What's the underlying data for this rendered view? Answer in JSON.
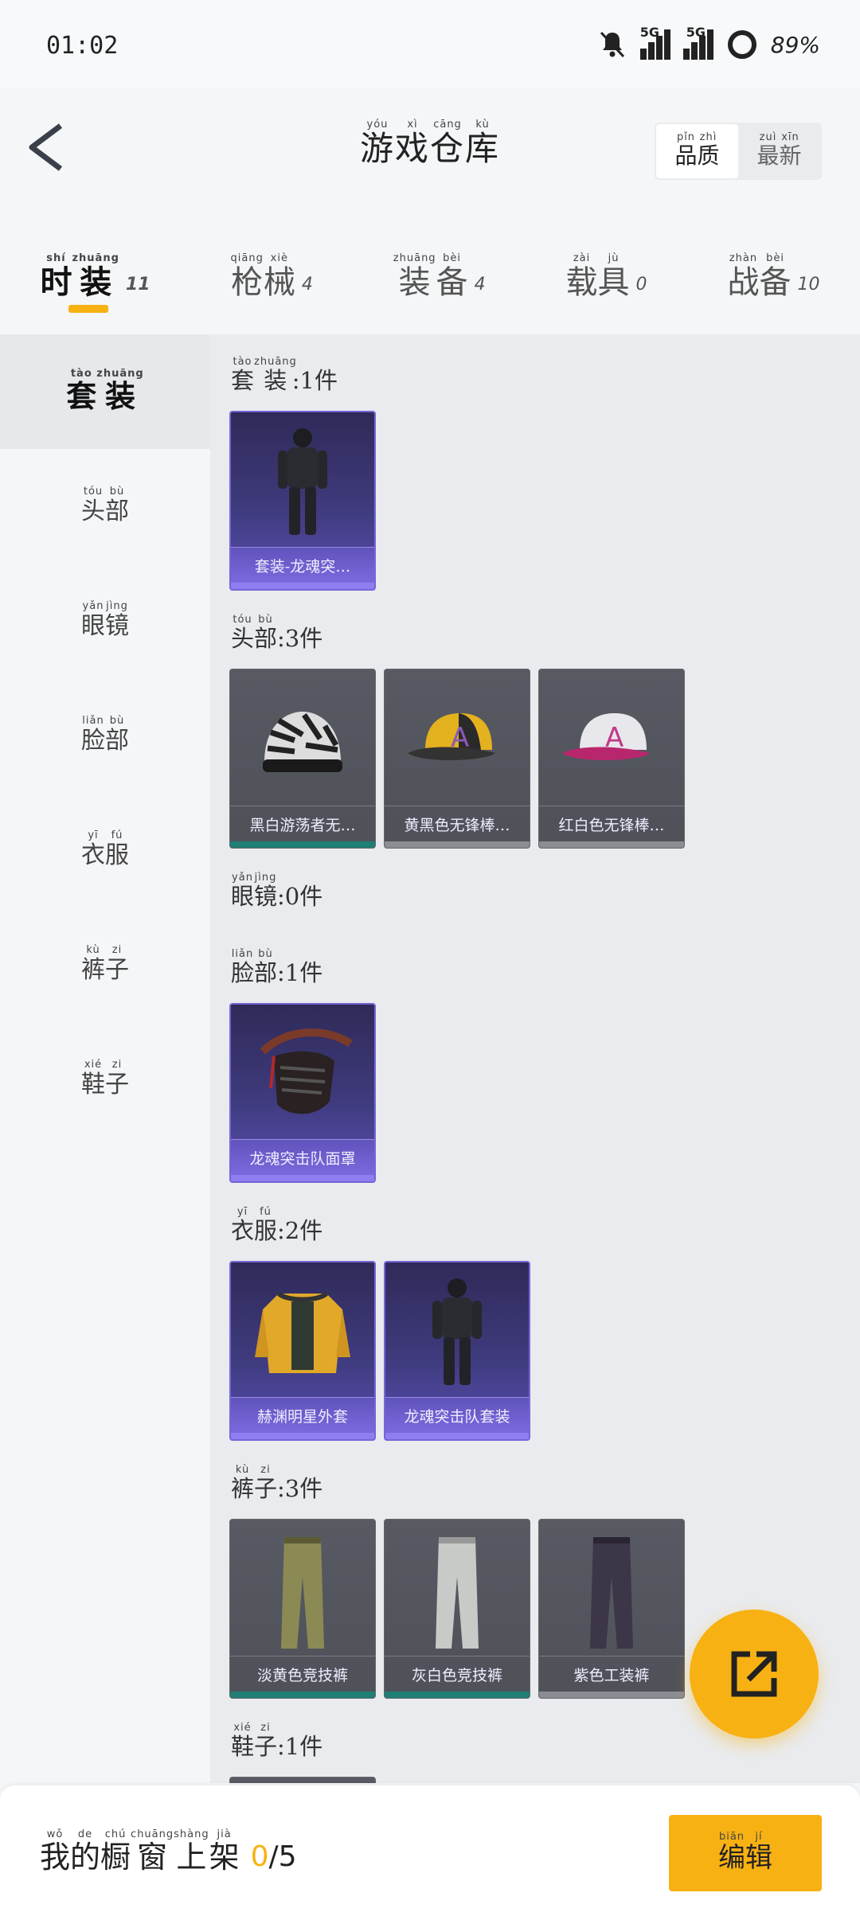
{
  "status_bar": {
    "time": "01:02",
    "signal_1": "5G",
    "signal_2": "5G",
    "battery": "89%"
  },
  "header": {
    "title": "游戏仓库",
    "title_pinyin": [
      "yóu",
      "xì",
      "cāng",
      "kù"
    ],
    "sort_options": [
      {
        "label": "品质",
        "pinyin": [
          "pǐn",
          "zhì"
        ],
        "active": true
      },
      {
        "label": "最新",
        "pinyin": [
          "zuì",
          "xīn"
        ],
        "active": false
      }
    ]
  },
  "tabs": [
    {
      "label": "时装",
      "pinyin": [
        "shí",
        "zhuāng"
      ],
      "count": "11",
      "active": true
    },
    {
      "label": "枪械",
      "pinyin": [
        "qiāng",
        "xiè"
      ],
      "count": "4",
      "active": false
    },
    {
      "label": "装备",
      "pinyin": [
        "zhuāng",
        "bèi"
      ],
      "count": "4",
      "active": false
    },
    {
      "label": "载具",
      "pinyin": [
        "zài",
        "jù"
      ],
      "count": "0",
      "active": false
    },
    {
      "label": "战备",
      "pinyin": [
        "zhàn",
        "bèi"
      ],
      "count": "10",
      "active": false
    }
  ],
  "sidebar": {
    "items": [
      {
        "label": "套装",
        "pinyin": [
          "tào",
          "zhuāng"
        ],
        "active": true
      },
      {
        "label": "头部",
        "pinyin": [
          "tóu",
          "bù"
        ],
        "active": false
      },
      {
        "label": "眼镜",
        "pinyin": [
          "yǎn",
          "jìng"
        ],
        "active": false
      },
      {
        "label": "脸部",
        "pinyin": [
          "liǎn",
          "bù"
        ],
        "active": false
      },
      {
        "label": "衣服",
        "pinyin": [
          "yī",
          "fú"
        ],
        "active": false
      },
      {
        "label": "裤子",
        "pinyin": [
          "kù",
          "zi"
        ],
        "active": false
      },
      {
        "label": "鞋子",
        "pinyin": [
          "xié",
          "zi"
        ],
        "active": false
      }
    ]
  },
  "sections": [
    {
      "label": "套装",
      "pinyin": [
        "tào",
        "zhuāng"
      ],
      "count": "1件",
      "items": [
        {
          "name": "套装-龙魂突…",
          "style": "purple",
          "icon": "armored-suit-icon"
        }
      ]
    },
    {
      "label": "头部",
      "pinyin": [
        "tóu",
        "bù"
      ],
      "count": "3件",
      "items": [
        {
          "name": "黑白游荡者无…",
          "style": "gray",
          "foot": "teal",
          "icon": "zebra-beanie-icon"
        },
        {
          "name": "黄黑色无锋棒…",
          "style": "gray",
          "foot": "gray",
          "icon": "yellow-cap-icon"
        },
        {
          "name": "红白色无锋棒…",
          "style": "gray",
          "foot": "gray",
          "icon": "pink-cap-icon"
        }
      ]
    },
    {
      "label": "眼镜",
      "pinyin": [
        "yǎn",
        "jìng"
      ],
      "count": "0件",
      "items": []
    },
    {
      "label": "脸部",
      "pinyin": [
        "liǎn",
        "bù"
      ],
      "count": "1件",
      "items": [
        {
          "name": "龙魂突击队面罩",
          "style": "purple",
          "icon": "face-mask-icon"
        }
      ]
    },
    {
      "label": "衣服",
      "pinyin": [
        "yī",
        "fú"
      ],
      "count": "2件",
      "items": [
        {
          "name": "赫渊明星外套",
          "style": "purple",
          "icon": "yellow-jacket-icon"
        },
        {
          "name": "龙魂突击队套装",
          "style": "purple",
          "icon": "armored-suit-icon"
        }
      ]
    },
    {
      "label": "裤子",
      "pinyin": [
        "kù",
        "zi"
      ],
      "count": "3件",
      "items": [
        {
          "name": "淡黄色竞技裤",
          "style": "gray",
          "foot": "teal",
          "icon": "khaki-pants-icon"
        },
        {
          "name": "灰白色竞技裤",
          "style": "gray",
          "foot": "teal",
          "icon": "white-pants-icon"
        },
        {
          "name": "紫色工装裤",
          "style": "gray",
          "foot": "gray",
          "icon": "purple-pants-icon"
        }
      ]
    },
    {
      "label": "鞋子",
      "pinyin": [
        "xié",
        "zi"
      ],
      "count": "1件",
      "items": []
    }
  ],
  "bottom_bar": {
    "shelf_label": "我的橱窗上架",
    "shelf_pinyin": [
      "wǒ",
      "de",
      "chú",
      "chuāng",
      "shàng",
      "jià"
    ],
    "shelf_current": "0",
    "shelf_total": "/5",
    "edit_label": "编辑",
    "edit_pinyin": [
      "biān",
      "jí"
    ]
  },
  "colors": {
    "accent": "#f8b112",
    "purple_card": "#3f3b7e",
    "gray_card": "#55575f",
    "teal": "#1f7f76"
  }
}
